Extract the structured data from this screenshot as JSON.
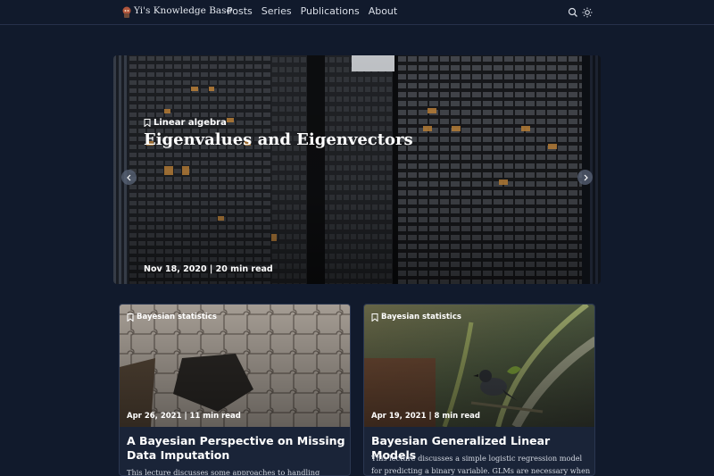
{
  "brand": {
    "name": "Yi's Knowledge Base"
  },
  "nav": {
    "items": [
      "Posts",
      "Series",
      "Publications",
      "About"
    ]
  },
  "icons": {
    "search": "search-icon",
    "theme": "sun-icon",
    "bookmark": "bookmark-icon",
    "prev": "chevron-left-icon",
    "next": "chevron-right-icon"
  },
  "featured": {
    "category": "Linear algebra",
    "title": "Eigenvalues and Eigenvectors",
    "meta": "Nov 18, 2020 | 20 min read"
  },
  "cards": [
    {
      "category": "Bayesian statistics",
      "meta": "Apr 26, 2021 | 11 min read",
      "title": "A Bayesian Perspective on Missing Data Imputation",
      "excerpt": "This lecture discusses some approaches to handling missing"
    },
    {
      "category": "Bayesian statistics",
      "meta": "Apr 19, 2021 | 8 min read",
      "title": "Bayesian Generalized Linear Models",
      "excerpt": "This lecture discusses a simple logistic regression model for predicting a binary variable. GLMs are necessary when the"
    }
  ],
  "colors": {
    "background": "#111a2c",
    "card": "#1a2438",
    "border": "#2a3650",
    "text": "#ffffff"
  }
}
